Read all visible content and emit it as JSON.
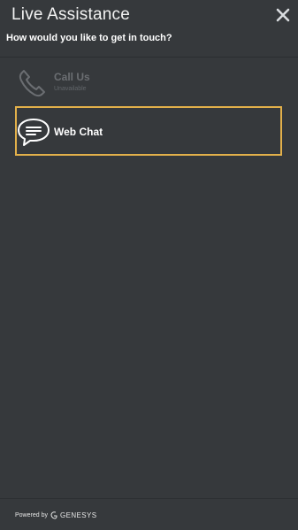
{
  "header": {
    "title": "Live Assistance",
    "subtitle": "How would you like to get in touch?"
  },
  "options": [
    {
      "label": "Call Us",
      "sublabel": "Unavailable",
      "icon": "phone-icon",
      "available": false
    },
    {
      "label": "Web Chat",
      "icon": "chat-bubble-icon",
      "available": true,
      "selected": true
    }
  ],
  "footer": {
    "powered_by": "Powered by",
    "brand": "GENESYS"
  },
  "colors": {
    "background": "#36393c",
    "focus_border": "#e2b04a",
    "disabled_text": "#6b6e72"
  }
}
